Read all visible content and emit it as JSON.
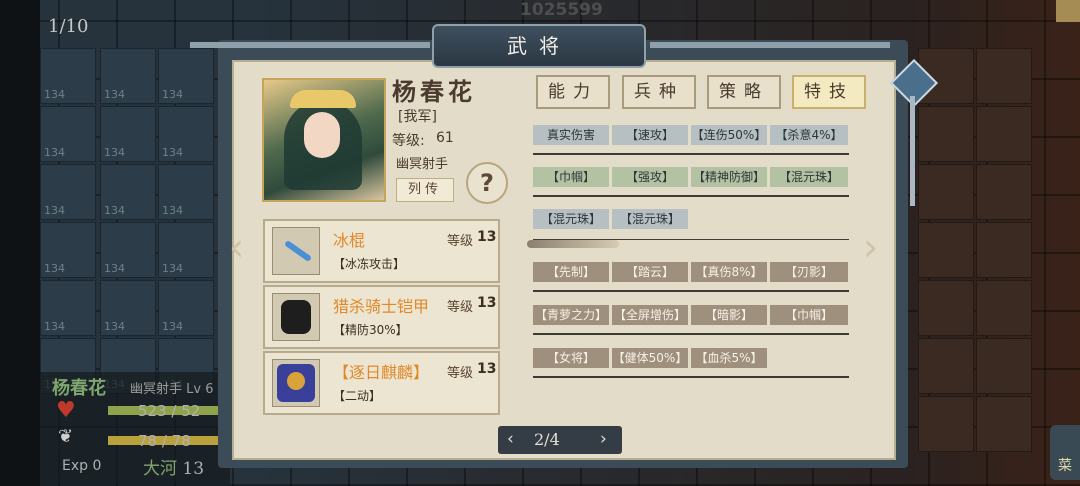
{
  "background": {
    "page_counter": "1/10",
    "gold_amount": "1025599",
    "cell_number": "134"
  },
  "hud": {
    "name": "杨春花",
    "class_level": "幽冥射手 Lv 6",
    "hp": "523 / 52",
    "mp": "78 / 78",
    "exp": "Exp 0",
    "place": "大河",
    "place_num": "13",
    "hp_color": "#8fa34a",
    "mp_color": "#b9a23e"
  },
  "panel": {
    "title": "武将",
    "hero": {
      "name": "杨春花",
      "faction": "[我军]",
      "level_label": "等级:",
      "level": "61",
      "class": "幽冥射手",
      "biography_button": "列传",
      "help_button": "?"
    },
    "equipment": [
      {
        "name": "冰棍",
        "level_label": "等级",
        "level": "13",
        "effect": "【冰冻攻击】",
        "icon": "ice-stick-icon"
      },
      {
        "name": "猎杀骑士铠甲",
        "level_label": "等级",
        "level": "13",
        "effect": "【精防30%】",
        "icon": "armor-icon"
      },
      {
        "name": "【逐日麒麟】",
        "level_label": "等级",
        "level": "13",
        "effect": "【二动】",
        "icon": "qilin-mount-icon"
      }
    ],
    "tabs": [
      "能力",
      "兵种",
      "策略",
      "特技"
    ],
    "active_tab": "特技",
    "skills_row1": [
      "真实伤害",
      "【速攻】",
      "【连伤50%】",
      "【杀意4%】"
    ],
    "skills_row2": [
      "【巾帼】",
      "【强攻】",
      "【精神防御】",
      "【混元珠】"
    ],
    "skills_row3": [
      "【混元珠】",
      "【混元珠】"
    ],
    "skills_row4": [
      "【先制】",
      "【踏云】",
      "【真伤8%】",
      "【刃影】"
    ],
    "skills_row5": [
      "【青萝之力】",
      "【全屏增伤】",
      "【暗影】",
      "【巾帼】"
    ],
    "skills_row6": [
      "【女将】",
      "【健体50%】",
      "【血杀5%】"
    ],
    "pager": {
      "text": "2/4",
      "prev": "‹",
      "next": "›"
    },
    "nav": {
      "left": "‹",
      "right": "›"
    }
  },
  "colors": {
    "panel_bg": "#e3dcc9",
    "equip_name": "#e1892a",
    "skill_gray": "#b6c0c2",
    "skill_green": "#b3c2a2",
    "skill_brown": "#9f8f7d"
  },
  "side_menu_label": "菜"
}
